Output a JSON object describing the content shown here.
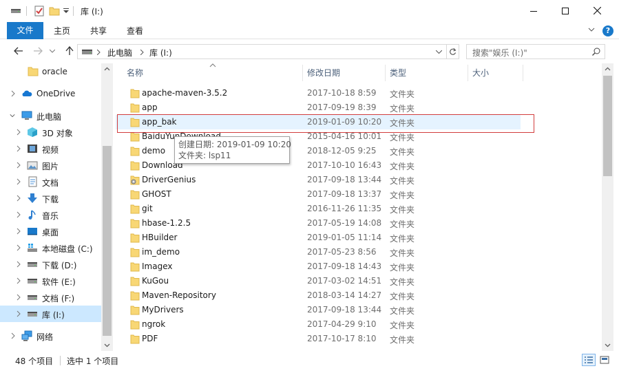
{
  "window": {
    "title": "库 (I:)",
    "minimize_icon": "minimize-icon",
    "maximize_icon": "maximize-icon",
    "close_icon": "close-icon"
  },
  "ribbon": {
    "tabs": [
      "文件",
      "主页",
      "共享",
      "查看"
    ],
    "help": "?",
    "accent": "#1979ca"
  },
  "address_bar": {
    "path": [
      "此电脑",
      "库 (I:)"
    ],
    "search_placeholder": "搜索\"娱乐 (I:)\""
  },
  "sidebar": {
    "items": [
      {
        "label": "oracle",
        "icon": "folder-icon",
        "level": 2,
        "expandable": false,
        "selected": false
      },
      {
        "label": "OneDrive",
        "icon": "onedrive-icon",
        "level": 1,
        "expandable": true,
        "selected": false
      },
      {
        "label": "此电脑",
        "icon": "pc-icon",
        "level": 1,
        "expandable": true,
        "expanded": true,
        "selected": false
      },
      {
        "label": "3D 对象",
        "icon": "3d-objects-icon",
        "level": 2,
        "expandable": true,
        "selected": false
      },
      {
        "label": "视频",
        "icon": "video-icon",
        "level": 2,
        "expandable": true,
        "selected": false
      },
      {
        "label": "图片",
        "icon": "pictures-icon",
        "level": 2,
        "expandable": true,
        "selected": false
      },
      {
        "label": "文档",
        "icon": "documents-icon",
        "level": 2,
        "expandable": true,
        "selected": false
      },
      {
        "label": "下载",
        "icon": "downloads-icon",
        "level": 2,
        "expandable": true,
        "selected": false
      },
      {
        "label": "音乐",
        "icon": "music-icon",
        "level": 2,
        "expandable": true,
        "selected": false
      },
      {
        "label": "桌面",
        "icon": "desktop-icon",
        "level": 2,
        "expandable": true,
        "selected": false
      },
      {
        "label": "本地磁盘 (C:)",
        "icon": "system-drive-icon",
        "level": 2,
        "expandable": true,
        "selected": false
      },
      {
        "label": "下载 (D:)",
        "icon": "drive-icon",
        "level": 2,
        "expandable": true,
        "selected": false
      },
      {
        "label": "软件 (E:)",
        "icon": "drive-icon",
        "level": 2,
        "expandable": true,
        "selected": false
      },
      {
        "label": "文档 (F:)",
        "icon": "drive-icon",
        "level": 2,
        "expandable": true,
        "selected": false
      },
      {
        "label": "库 (I:)",
        "icon": "drive-icon",
        "level": 2,
        "expandable": true,
        "selected": true
      },
      {
        "label": "网络",
        "icon": "network-icon",
        "level": 1,
        "expandable": true,
        "selected": false
      }
    ]
  },
  "file_list": {
    "columns": [
      "名称",
      "修改日期",
      "类型",
      "大小"
    ],
    "rows": [
      {
        "name": "apache-maven-3.5.2",
        "date": "2017-10-18 8:59",
        "type": "文件夹",
        "icon": "folder-icon"
      },
      {
        "name": "app",
        "date": "2017-09-19 8:39",
        "type": "文件夹",
        "icon": "folder-icon"
      },
      {
        "name": "app_bak",
        "date": "2019-01-09 10:20",
        "type": "文件夹",
        "icon": "folder-icon"
      },
      {
        "name": "BaiduYunDownload",
        "date": "2015-04-16 10:01",
        "type": "文件夹",
        "icon": "folder-icon"
      },
      {
        "name": "demo",
        "date": "2018-12-05 9:25",
        "type": "文件夹",
        "icon": "folder-icon"
      },
      {
        "name": "Download",
        "date": "2017-10-10 16:43",
        "type": "文件夹",
        "icon": "folder-icon"
      },
      {
        "name": "DriverGenius",
        "date": "2017-09-18 13:44",
        "type": "文件夹",
        "icon": "folder-gear-icon"
      },
      {
        "name": "GHOST",
        "date": "2017-09-18 13:37",
        "type": "文件夹",
        "icon": "folder-icon"
      },
      {
        "name": "git",
        "date": "2016-11-26 11:35",
        "type": "文件夹",
        "icon": "folder-icon"
      },
      {
        "name": "hbase-1.2.5",
        "date": "2017-05-19 14:08",
        "type": "文件夹",
        "icon": "folder-icon"
      },
      {
        "name": "HBuilder",
        "date": "2019-01-05 11:14",
        "type": "文件夹",
        "icon": "folder-icon"
      },
      {
        "name": "im_demo",
        "date": "2017-05-23 8:56",
        "type": "文件夹",
        "icon": "folder-icon"
      },
      {
        "name": "Imagex",
        "date": "2017-09-18 14:43",
        "type": "文件夹",
        "icon": "folder-icon"
      },
      {
        "name": "KuGou",
        "date": "2017-03-02 14:51",
        "type": "文件夹",
        "icon": "folder-icon"
      },
      {
        "name": "Maven-Repository",
        "date": "2018-03-14 14:27",
        "type": "文件夹",
        "icon": "folder-icon"
      },
      {
        "name": "MyDrivers",
        "date": "2017-09-18 13:44",
        "type": "文件夹",
        "icon": "folder-icon"
      },
      {
        "name": "ngrok",
        "date": "2017-04-29 9:10",
        "type": "文件夹",
        "icon": "folder-icon"
      },
      {
        "name": "PDF",
        "date": "2017-10-17 8:10",
        "type": "文件夹",
        "icon": "folder-icon"
      }
    ],
    "hovered_row": 2
  },
  "tooltip": {
    "line1": "创建日期: 2019-01-09 10:20",
    "line2": "文件夹: lsp11"
  },
  "status_bar": {
    "item_count": "48 个项目",
    "selection": "选中 1 个项目"
  },
  "colors": {
    "folder": "#f8d775",
    "selection": "#cce8ff",
    "hover": "#e5f3ff",
    "highlight_box": "#d23c3c"
  }
}
